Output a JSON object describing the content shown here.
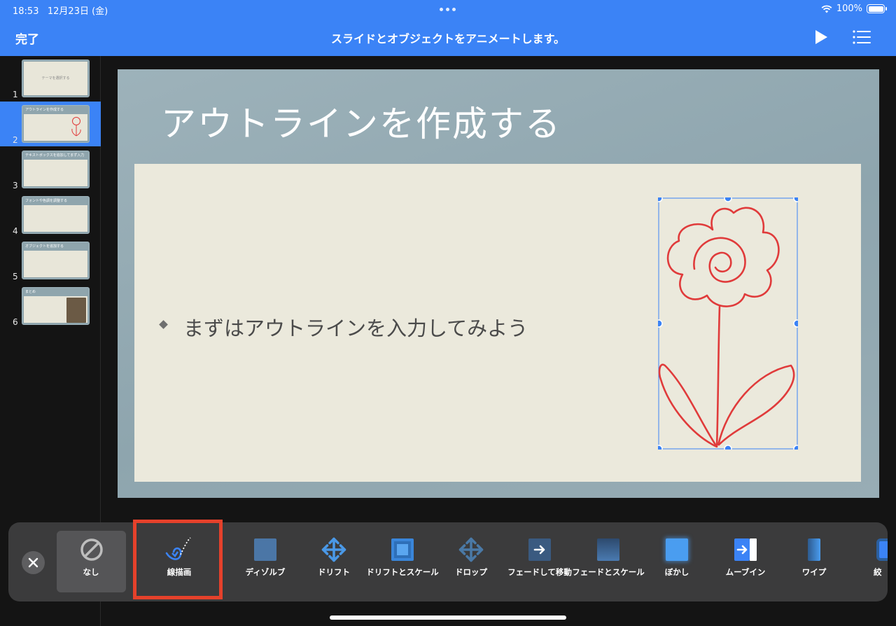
{
  "status_bar": {
    "time": "18:53",
    "date": "12月23日 (金)",
    "battery": "100%"
  },
  "nav": {
    "done_label": "完了",
    "title": "スライドとオブジェクトをアニメートします。"
  },
  "slides": [
    {
      "number": "1",
      "title": "テーマを選択する"
    },
    {
      "number": "2",
      "title": "アウトラインを作成する"
    },
    {
      "number": "3",
      "title": "テキストボックスを追加してまず入力"
    },
    {
      "number": "4",
      "title": "フォントや色調を調整する"
    },
    {
      "number": "5",
      "title": "オブジェクトを追加する"
    },
    {
      "number": "6",
      "title": "まとめ"
    }
  ],
  "selected_slide": 2,
  "slide": {
    "title": "アウトラインを作成する",
    "bullet": "まずはアウトラインを入力してみよう"
  },
  "animations": {
    "none_label": "なし",
    "items": [
      {
        "label": "線描画",
        "icon": "line-draw-icon"
      },
      {
        "label": "ディゾルブ",
        "icon": "dissolve-icon"
      },
      {
        "label": "ドリフト",
        "icon": "drift-icon"
      },
      {
        "label": "ドリフトとスケール",
        "icon": "drift-scale-icon"
      },
      {
        "label": "ドロップ",
        "icon": "drop-icon"
      },
      {
        "label": "フェードして移動",
        "icon": "fade-move-icon"
      },
      {
        "label": "フェードとスケール",
        "icon": "fade-scale-icon"
      },
      {
        "label": "ぼかし",
        "icon": "blur-icon"
      },
      {
        "label": "ムーブイン",
        "icon": "move-in-icon"
      },
      {
        "label": "ワイプ",
        "icon": "wipe-icon"
      },
      {
        "label": "絞",
        "icon": "iris-icon"
      }
    ]
  },
  "colors": {
    "accent": "#3b83f6",
    "highlight": "#e5412b",
    "drawing": "#e03b3b"
  }
}
